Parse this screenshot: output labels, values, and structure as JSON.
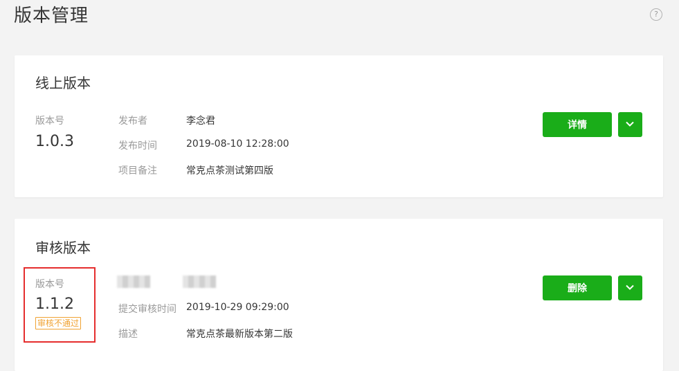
{
  "page": {
    "title": "版本管理",
    "help_icon": "?"
  },
  "online": {
    "title": "线上版本",
    "version_label": "版本号",
    "version": "1.0.3",
    "fields": [
      {
        "label": "发布者",
        "value": "李念君"
      },
      {
        "label": "发布时间",
        "value": "2019-08-10 12:28:00"
      },
      {
        "label": "项目备注",
        "value": "常克点茶测试第四版"
      }
    ],
    "primary_button": "详情"
  },
  "review": {
    "title": "审核版本",
    "version_label": "版本号",
    "version": "1.1.2",
    "status": "审核不通过",
    "fields": [
      {
        "label": "提交审核时间",
        "value": "2019-10-29 09:29:00"
      },
      {
        "label": "描述",
        "value": "常克点茶最新版本第二版"
      }
    ],
    "primary_button": "删除"
  },
  "colors": {
    "accent": "#1aad19",
    "warning": "#f0a232",
    "highlight": "#e52d2d"
  }
}
